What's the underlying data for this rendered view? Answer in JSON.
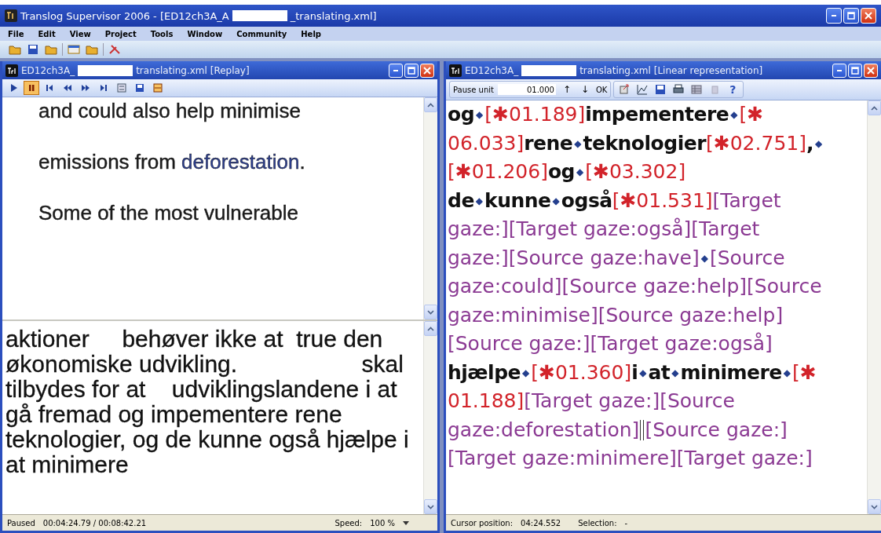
{
  "window": {
    "title_start": "Translog Supervisor 2006 - [ED12ch3A_A",
    "title_end": "_translating.xml]",
    "redacted": true
  },
  "menu": [
    "File",
    "Edit",
    "View",
    "Project",
    "Tools",
    "Window",
    "Community",
    "Help"
  ],
  "replay_window": {
    "title_start": "ED12ch3A_",
    "title_end": "translating.xml [Replay]",
    "redacted": true,
    "paused": true,
    "source_lines": [
      [
        {
          "text": "and could also help minimise",
          "kind": "plain"
        }
      ],
      [
        {
          "text": "emissions from ",
          "kind": "plain"
        },
        {
          "text": "deforestation",
          "kind": "highlight"
        },
        {
          "text": ".",
          "kind": "plain"
        }
      ],
      [
        {
          "text": "Some of the most vulnerable",
          "kind": "plain"
        }
      ]
    ],
    "target_lines": [
      "aktioner     behøver ikke at  true den",
      "økonomiske udvikling.                   skal",
      "tilbydes for at    udviklingslandene i at",
      "gå fremad og impementere rene",
      "teknologier, og de kunne også hjælpe i",
      "at minimere"
    ],
    "status": {
      "state": "Paused",
      "time": "00:04:24.79 / 00:08:42.21",
      "speed_label": "Speed:",
      "speed": "100 %"
    }
  },
  "linear_window": {
    "title_start": "ED12ch3A_",
    "title_end": "translating.xml [Linear representation]",
    "redacted": true,
    "toolbar": {
      "pause_unit_label": "Pause unit",
      "pause_unit_value": "01.000",
      "up": "↑",
      "down": "↓",
      "ok": "OK",
      "help": "?"
    },
    "lines": [
      [
        {
          "kind": "word",
          "text": "og"
        },
        {
          "kind": "space",
          "text": "◆"
        },
        {
          "kind": "pause",
          "text": "[✱01.189]"
        },
        {
          "kind": "word",
          "text": "impementere"
        },
        {
          "kind": "space",
          "text": "◆"
        },
        {
          "kind": "pause",
          "text": "[✱"
        }
      ],
      [
        {
          "kind": "pause",
          "text": "06.033]"
        },
        {
          "kind": "word",
          "text": "rene"
        },
        {
          "kind": "space",
          "text": "◆"
        },
        {
          "kind": "word",
          "text": "teknologier"
        },
        {
          "kind": "pause",
          "text": "[✱02.751]"
        },
        {
          "kind": "word",
          "text": ","
        },
        {
          "kind": "space",
          "text": "◆"
        }
      ],
      [
        {
          "kind": "pause",
          "text": "[✱01.206]"
        },
        {
          "kind": "word",
          "text": "og"
        },
        {
          "kind": "space",
          "text": "◆"
        },
        {
          "kind": "pause",
          "text": "[✱03.302]"
        }
      ],
      [
        {
          "kind": "word",
          "text": "de"
        },
        {
          "kind": "space",
          "text": "◆"
        },
        {
          "kind": "word",
          "text": "kunne"
        },
        {
          "kind": "space",
          "text": "◆"
        },
        {
          "kind": "word",
          "text": "også"
        },
        {
          "kind": "pause",
          "text": "[✱01.531]"
        },
        {
          "kind": "gaze",
          "text": "[Target"
        }
      ],
      [
        {
          "kind": "gaze",
          "text": "gaze:][Target gaze:også][Target"
        }
      ],
      [
        {
          "kind": "gaze",
          "text": "gaze:][Source gaze:have]"
        },
        {
          "kind": "space",
          "text": "◆"
        },
        {
          "kind": "gaze",
          "text": "[Source"
        }
      ],
      [
        {
          "kind": "gaze",
          "text": "gaze:could][Source gaze:help][Source"
        }
      ],
      [
        {
          "kind": "gaze",
          "text": "gaze:minimise][Source gaze:help]"
        }
      ],
      [
        {
          "kind": "gaze",
          "text": "[Source gaze:][Target gaze:også]"
        }
      ],
      [
        {
          "kind": "word",
          "text": "hjælpe"
        },
        {
          "kind": "space",
          "text": "◆"
        },
        {
          "kind": "pause",
          "text": "[✱01.360]"
        },
        {
          "kind": "word",
          "text": "i"
        },
        {
          "kind": "space",
          "text": "◆"
        },
        {
          "kind": "word",
          "text": "at"
        },
        {
          "kind": "space",
          "text": "◆"
        },
        {
          "kind": "word",
          "text": "minimere"
        },
        {
          "kind": "space",
          "text": "◆"
        },
        {
          "kind": "pause",
          "text": "[✱"
        }
      ],
      [
        {
          "kind": "pause",
          "text": "01.188]"
        },
        {
          "kind": "gaze",
          "text": "[Target gaze:][Source"
        }
      ],
      [
        {
          "kind": "gaze",
          "text": "gaze:deforestation]"
        },
        {
          "kind": "cursor"
        },
        {
          "kind": "gaze",
          "text": "[Source gaze:]"
        }
      ],
      [
        {
          "kind": "gaze",
          "text": "[Target gaze:minimere][Target gaze:]"
        }
      ]
    ],
    "status": {
      "cursor_label": "Cursor position:",
      "cursor": "04:24.552",
      "selection_label": "Selection:",
      "selection": "-"
    }
  }
}
